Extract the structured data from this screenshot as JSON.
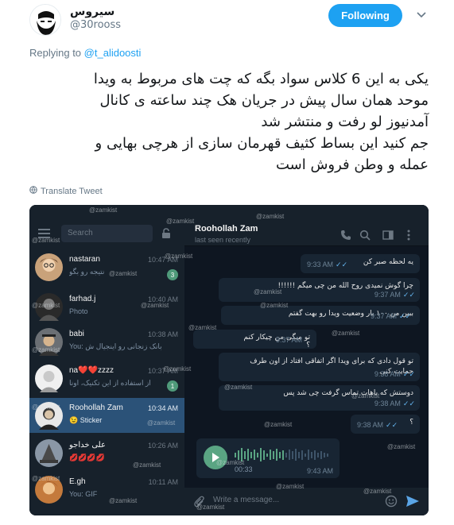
{
  "tweet": {
    "display_name": "سیروس",
    "handle": "@30rooss",
    "follow_label": "Following",
    "replying_prefix": "Replying to",
    "replying_to": "@t_alidoosti",
    "text_lines": [
      "یکی به این 6 کلاس سواد بگه که چت های مربوط به ویدا",
      "موحد همان سال پیش در جریان هک چند ساعته ی کانال",
      "آمدنیوز لو رفت و منتشر شد",
      "جم کنید این بساط کثیف قهرمان سازی از هرچی بهایی و",
      "عمله و وطن فروش است"
    ],
    "translate_label": "Translate Tweet",
    "colors": {
      "accent": "#1da1f2"
    }
  },
  "telegram": {
    "search_placeholder": "Search",
    "watermark": "@zamkist",
    "chats": [
      {
        "name": "nastaran",
        "preview": "نتیجه رو بگو",
        "time": "10:47 AM",
        "badge": "3"
      },
      {
        "name": "farhad.j",
        "preview": "Photo",
        "time": "10:40 AM",
        "badge": ""
      },
      {
        "name": "babi",
        "preview": "You: بانک زنجانی رو اینجیال ش",
        "time": "10:38 AM",
        "badge": ""
      },
      {
        "name": "na❤️❤️zzzz",
        "preview": "از استفاده از این تکنیک، اونا",
        "time": "10:37 AM",
        "badge": "1"
      },
      {
        "name": "Roohollah Zam",
        "preview": "😉 Sticker",
        "time": "10:34 AM",
        "badge": ""
      },
      {
        "name": "علی خداجو",
        "preview": "💋💋💋💋",
        "time": "10:26 AM",
        "badge": ""
      },
      {
        "name": "E.gh",
        "preview": "You: GIF",
        "time": "10:11 AM",
        "badge": ""
      }
    ],
    "chat_header": {
      "title": "Roohollah Zam",
      "status": "last seen recently"
    },
    "messages": [
      {
        "text": "یه لحظه صبر کن",
        "time": "9:33 AM"
      },
      {
        "text": "چرا گوش نمیدی  روح الله من چی میگم  !!!!!!",
        "time": "9:37 AM"
      },
      {
        "text": "ببین من ۱۰۰ بار وضعیت ویدا رو بهت گفتم",
        "time": "9:37 AM"
      },
      {
        "text": "تو میگی من چیکار کنم ؟",
        "time": "9:37 AM"
      },
      {
        "text": "تو قول دادی که برای ویدا اگر اتفاقی افتاد از اون طرف حمایت کنی",
        "time": "9:38 AM"
      },
      {
        "text": "دوستش که باهات تماس گرفت چی شد پس",
        "time": "9:38 AM"
      },
      {
        "text": "؟",
        "time": "9:38 AM"
      }
    ],
    "voice": {
      "duration": "00:33",
      "time": "9:43 AM"
    },
    "compose_placeholder": "Write a message..."
  }
}
